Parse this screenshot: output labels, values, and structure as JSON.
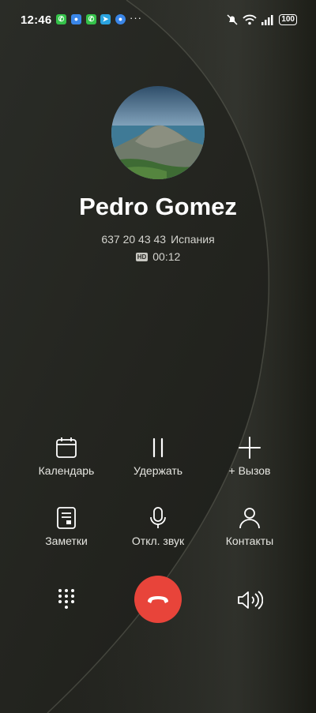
{
  "status_bar": {
    "time": "12:46",
    "more": "···",
    "battery": "100"
  },
  "contact": {
    "name": "Pedro Gomez",
    "number": "637 20 43 43",
    "location": "Испания",
    "hd_badge": "HD",
    "duration": "00:12"
  },
  "actions": {
    "calendar": "Календарь",
    "hold": "Удержать",
    "add_call": "+ Вызов",
    "notes": "Заметки",
    "mute": "Откл. звук",
    "contacts": "Контакты"
  },
  "bottom": {
    "keypad_icon": "dialpad-icon",
    "end_icon": "end-call-icon",
    "speaker_icon": "speaker-icon"
  },
  "colors": {
    "end_call": "#e8443a",
    "background": "#23241f"
  }
}
